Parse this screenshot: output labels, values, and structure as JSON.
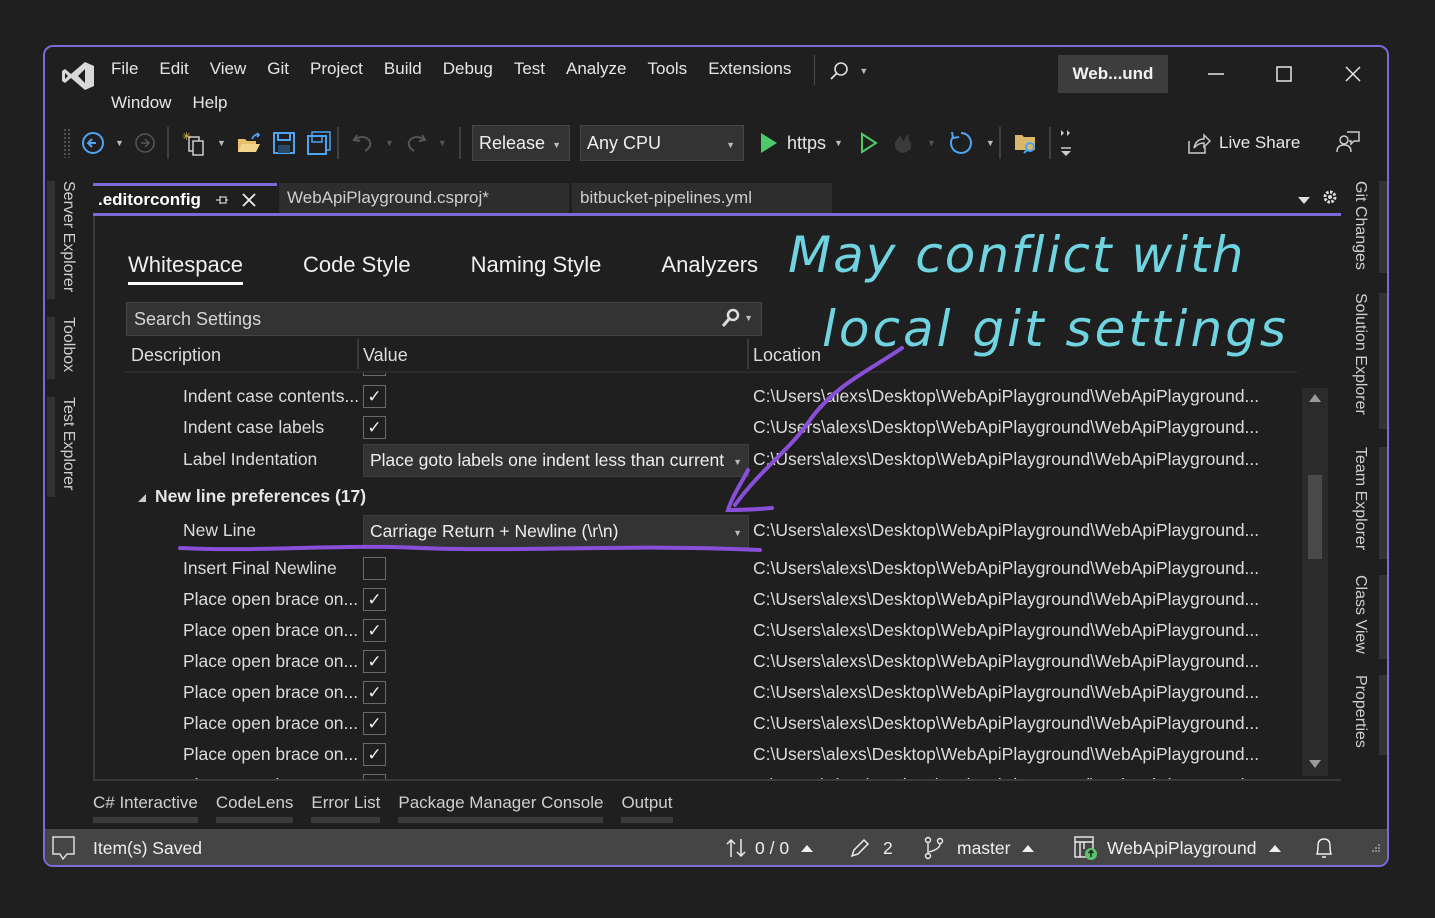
{
  "titlebar": {
    "menu_row1": [
      "File",
      "Edit",
      "View",
      "Git",
      "Project",
      "Build",
      "Debug",
      "Test",
      "Analyze",
      "Tools",
      "Extensions"
    ],
    "menu_row2": [
      "Window",
      "Help"
    ],
    "solution_badge": "Web...und",
    "window_controls": [
      "minimize-icon",
      "maximize-icon",
      "close-icon"
    ]
  },
  "toolbar": {
    "configuration": "Release",
    "platform": "Any CPU",
    "run_target": "https",
    "live_share_label": "Live Share",
    "icons": [
      "navigate-back-icon",
      "navigate-forward-icon",
      "new-project-icon",
      "open-folder-icon",
      "save-icon",
      "save-all-icon",
      "undo-icon",
      "redo-icon",
      "start-icon",
      "start-without-debugging-icon",
      "hot-reload-icon",
      "restart-icon",
      "solution-explorer-folder-icon",
      "toolbar-overflow-icon",
      "live-share-icon",
      "feedback-icon"
    ]
  },
  "left_tool_windows": [
    "Server Explorer",
    "Toolbox",
    "Test Explorer"
  ],
  "right_tool_windows": [
    "Git Changes",
    "Solution Explorer",
    "Team Explorer",
    "Class View",
    "Properties"
  ],
  "doc_tabs": [
    {
      "label": ".editorconfig",
      "active": true,
      "pinned": true
    },
    {
      "label": "WebApiPlayground.csproj*",
      "active": false
    },
    {
      "label": "bitbucket-pipelines.yml",
      "active": false
    }
  ],
  "editor": {
    "sub_tabs": [
      {
        "label": "Whitespace",
        "active": true
      },
      {
        "label": "Code Style",
        "active": false
      },
      {
        "label": "Naming Style",
        "active": false
      },
      {
        "label": "Analyzers",
        "active": false
      }
    ],
    "search_placeholder": "Search Settings",
    "columns": [
      "Description",
      "Value",
      "Location"
    ],
    "location_text": "C:\\Users\\alexs\\Desktop\\WebApiPlayground\\WebApiPlayground...",
    "rows": [
      {
        "type": "setting",
        "description": "Indent case contents...",
        "kind": "checkbox",
        "checked": true,
        "location": "C:\\Users\\alexs\\Desktop\\WebApiPlayground\\WebApiPlayground..."
      },
      {
        "type": "setting",
        "description": "Indent case labels",
        "kind": "checkbox",
        "checked": true,
        "location": "C:\\Users\\alexs\\Desktop\\WebApiPlayground\\WebApiPlayground..."
      },
      {
        "type": "setting",
        "description": "Label Indentation",
        "kind": "dropdown",
        "value": "Place goto labels one indent less than current",
        "location": "C:\\Users\\alexs\\Desktop\\WebApiPlayground\\WebApiPlayground..."
      },
      {
        "type": "group",
        "title": "New line preferences (17)",
        "expanded": true
      },
      {
        "type": "setting",
        "description": "New Line",
        "kind": "dropdown",
        "value": "Carriage Return + Newline (\\r\\n)",
        "location": "C:\\Users\\alexs\\Desktop\\WebApiPlayground\\WebApiPlayground..."
      },
      {
        "type": "setting",
        "description": "Insert Final Newline",
        "kind": "checkbox",
        "checked": false,
        "location": "C:\\Users\\alexs\\Desktop\\WebApiPlayground\\WebApiPlayground..."
      },
      {
        "type": "setting",
        "description": "Place open brace on...",
        "kind": "checkbox",
        "checked": true,
        "location": "C:\\Users\\alexs\\Desktop\\WebApiPlayground\\WebApiPlayground..."
      },
      {
        "type": "setting",
        "description": "Place open brace on...",
        "kind": "checkbox",
        "checked": true,
        "location": "C:\\Users\\alexs\\Desktop\\WebApiPlayground\\WebApiPlayground..."
      },
      {
        "type": "setting",
        "description": "Place open brace on...",
        "kind": "checkbox",
        "checked": true,
        "location": "C:\\Users\\alexs\\Desktop\\WebApiPlayground\\WebApiPlayground..."
      },
      {
        "type": "setting",
        "description": "Place open brace on...",
        "kind": "checkbox",
        "checked": true,
        "location": "C:\\Users\\alexs\\Desktop\\WebApiPlayground\\WebApiPlayground..."
      },
      {
        "type": "setting",
        "description": "Place open brace on...",
        "kind": "checkbox",
        "checked": true,
        "location": "C:\\Users\\alexs\\Desktop\\WebApiPlayground\\WebApiPlayground..."
      },
      {
        "type": "setting",
        "description": "Place open brace on...",
        "kind": "checkbox",
        "checked": true,
        "location": "C:\\Users\\alexs\\Desktop\\WebApiPlayground\\WebApiPlayground..."
      }
    ]
  },
  "bottom_tabs": [
    "C# Interactive",
    "CodeLens",
    "Error List",
    "Package Manager Console",
    "Output"
  ],
  "statusbar": {
    "message": "Item(s) Saved",
    "sync": "0 / 0",
    "pending_changes": "2",
    "branch": "master",
    "repository": "WebApiPlayground"
  },
  "annotation": {
    "line1": "May conflict with",
    "line2": "local git settings",
    "text_color": "#6fd3e0",
    "arrow_color": "#8a4fd8"
  },
  "colors": {
    "accent": "#7a6bd8",
    "background": "#1f1f1f",
    "statusbar": "#454545"
  }
}
